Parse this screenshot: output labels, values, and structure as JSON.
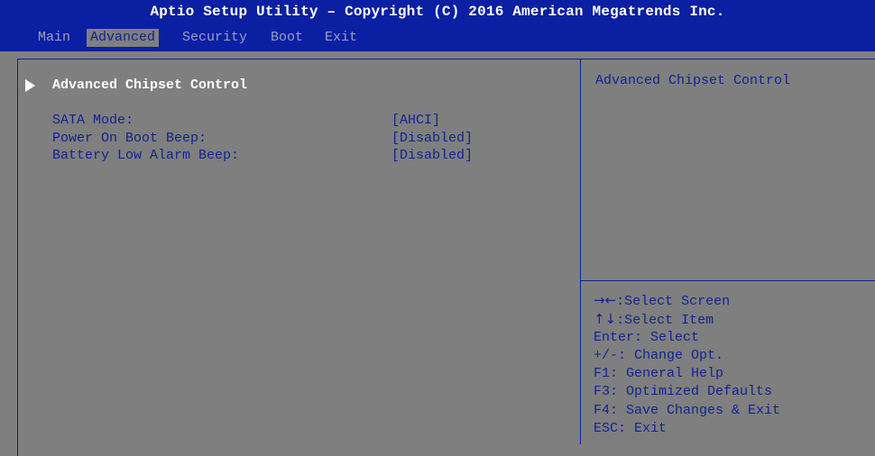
{
  "header": {
    "title": "Aptio Setup Utility – Copyright (C) 2016 American Megatrends Inc."
  },
  "menu": {
    "tabs": [
      {
        "label": "Main",
        "active": false
      },
      {
        "label": "Advanced",
        "active": true
      },
      {
        "label": "Security",
        "active": false
      },
      {
        "label": "Boot",
        "active": false
      },
      {
        "label": "Exit",
        "active": false
      }
    ]
  },
  "main": {
    "submenu": {
      "label": "Advanced Chipset Control",
      "icon": "triangle-right-icon"
    },
    "settings": [
      {
        "label": "SATA Mode:",
        "value": "[AHCI]"
      },
      {
        "label": "Power On Boot Beep:",
        "value": "[Disabled]"
      },
      {
        "label": "Battery Low Alarm Beep:",
        "value": "[Disabled]"
      }
    ]
  },
  "help": {
    "description": "Advanced Chipset Control",
    "keys": [
      {
        "glyph": "→←",
        "text": ":Select Screen"
      },
      {
        "glyph": "↑↓",
        "text": ":Select Item"
      },
      {
        "glyph": "",
        "text": "Enter: Select"
      },
      {
        "glyph": "",
        "text": "+/-: Change Opt."
      },
      {
        "glyph": "",
        "text": "F1: General Help"
      },
      {
        "glyph": "",
        "text": "F3: Optimized Defaults"
      },
      {
        "glyph": "",
        "text": "F4: Save Changes & Exit"
      },
      {
        "glyph": "",
        "text": "ESC: Exit"
      }
    ]
  },
  "colors": {
    "background": "#7f7f7f",
    "header": "#0b1fa3",
    "text_blue": "#12248f",
    "highlight": "#ffffff"
  }
}
